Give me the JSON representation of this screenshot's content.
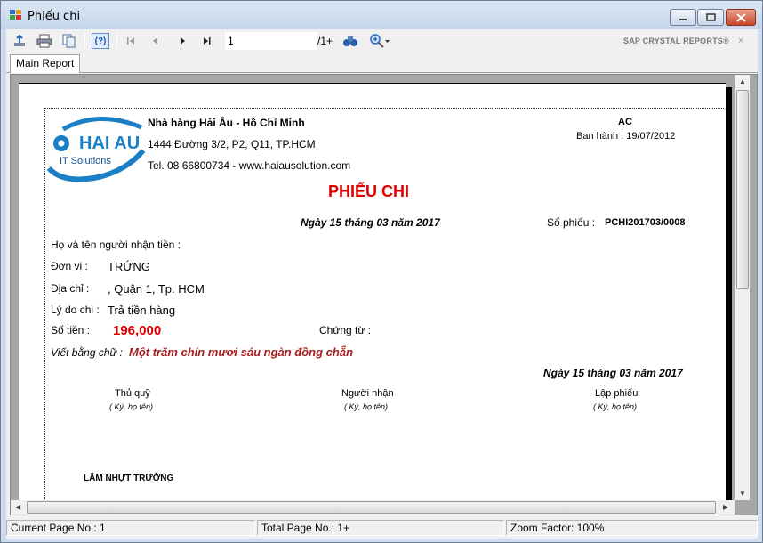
{
  "window": {
    "title": "Phiếu chi"
  },
  "toolbar": {
    "page_value": "1",
    "page_total": "/1+",
    "brand": "SAP CRYSTAL REPORTS®",
    "close_glyph": "×"
  },
  "tabs": [
    {
      "label": "Main Report"
    }
  ],
  "report": {
    "company_name": "Nhà hàng Hải Âu - Hồ Chí Minh",
    "address": "1444 Đường 3/2, P2, Q11, TP.HCM",
    "contact": "Tel. 08 66800734 - www.haiausolution.com",
    "logo_text1": "HAI AU",
    "logo_text2": "IT Solutions",
    "code": "AC",
    "issued": "Ban hành : 19/07/2012",
    "title": "PHIẾU CHI",
    "date": "Ngày 15 tháng 03 năm 2017",
    "voucher_label": "Số phiếu :",
    "voucher_no": "PCHI201703/0008",
    "recipient_label": "Họ và tên người nhận tiền :",
    "unit_label": "Đơn vị :",
    "unit_value": "TRỨNG",
    "address_label": "Địa chỉ :",
    "address_value": ", Quận 1, Tp. HCM",
    "reason_label": "Lý do chi :",
    "reason_value": "Trả tiền hàng",
    "amount_label": "Số tiền :",
    "amount_value": "196,000",
    "doc_label": "Chứng từ :",
    "words_label": "Viết bằng chữ :",
    "words_value": "Một trăm chín mươi sáu ngàn đồng chẵn",
    "date2": "Ngày 15 tháng 03 năm 2017",
    "sig1": "Thủ quỹ",
    "sig2": "Người nhận",
    "sig3": "Lập phiếu",
    "sig_hint": "( Ký, họ tên)",
    "signer": "LÂM NHỰT TRƯỜNG"
  },
  "status": {
    "current": "Current Page No.: 1",
    "total": "Total Page No.: 1+",
    "zoom": "Zoom Factor: 100%"
  },
  "colors": {
    "title_red": "#e00000",
    "words_red": "#a51c1c",
    "logo_blue": "#1a7fc4"
  }
}
